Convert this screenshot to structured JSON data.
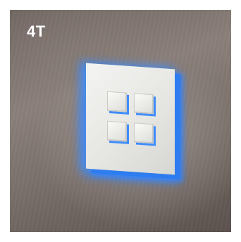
{
  "badge": {
    "label": "4T"
  },
  "device": {
    "type": "wall-mounted touch switch panel",
    "button_count": 4,
    "backlight_color": "#2d7cf0",
    "plate_color": "#efefec"
  }
}
